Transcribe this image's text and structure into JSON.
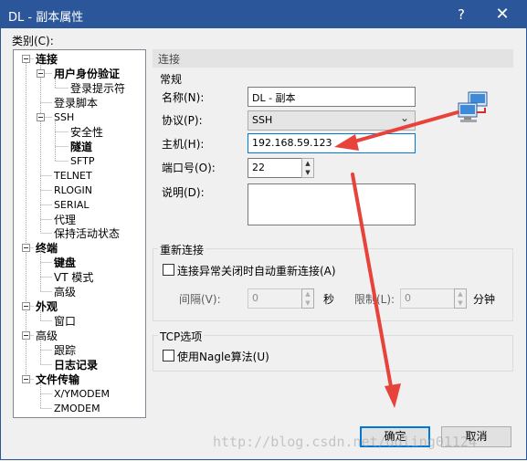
{
  "window": {
    "title": "DL - 副本属性",
    "help_glyph": "?",
    "close_glyph": "✕"
  },
  "category_label": "类别(C):",
  "tree": [
    {
      "label": "连接",
      "bold": true
    },
    {
      "label": "用户身份验证",
      "bold": true
    },
    {
      "label": "登录提示符",
      "bold": false
    },
    {
      "label": "登录脚本",
      "bold": false
    },
    {
      "label": "SSH",
      "bold": false
    },
    {
      "label": "安全性",
      "bold": false
    },
    {
      "label": "隧道",
      "bold": true
    },
    {
      "label": "SFTP",
      "bold": false
    },
    {
      "label": "TELNET",
      "bold": false
    },
    {
      "label": "RLOGIN",
      "bold": false
    },
    {
      "label": "SERIAL",
      "bold": false
    },
    {
      "label": "代理",
      "bold": false
    },
    {
      "label": "保持活动状态",
      "bold": false
    },
    {
      "label": "终端",
      "bold": true
    },
    {
      "label": "键盘",
      "bold": true
    },
    {
      "label": "VT 模式",
      "bold": false
    },
    {
      "label": "高级",
      "bold": false
    },
    {
      "label": "外观",
      "bold": true
    },
    {
      "label": "窗口",
      "bold": false
    },
    {
      "label": "高级",
      "bold": false
    },
    {
      "label": "跟踪",
      "bold": false
    },
    {
      "label": "日志记录",
      "bold": true
    },
    {
      "label": "文件传输",
      "bold": true
    },
    {
      "label": "X/YMODEM",
      "bold": false
    },
    {
      "label": "ZMODEM",
      "bold": false
    }
  ],
  "pane_title": "连接",
  "general": {
    "group_title": "常规",
    "name_label": "名称(N):",
    "name_value": "DL - 副本",
    "protocol_label": "协议(P):",
    "protocol_value": "SSH",
    "host_label": "主机(H):",
    "host_value": "192.168.59.123",
    "port_label": "端口号(O):",
    "port_value": "22",
    "desc_label": "说明(D):",
    "desc_value": ""
  },
  "reconnect": {
    "group_title": "重新连接",
    "checkbox_label": "连接异常关闭时自动重新连接(A)",
    "checked": false,
    "interval_label": "间隔(V):",
    "interval_value": "0",
    "interval_unit": "秒",
    "limit_label": "限制(L):",
    "limit_value": "0",
    "limit_unit": "分钟"
  },
  "tcp": {
    "group_title": "TCP选项",
    "nagle_label": "使用Nagle算法(U)",
    "checked": false
  },
  "buttons": {
    "ok": "确定",
    "cancel": "取消"
  },
  "watermark": "http://blog.csdn.net/ddling01124",
  "colors": {
    "titlebar": "#2b579a",
    "annotation_arrow": "#e8433a",
    "focus": "#0078d7"
  }
}
